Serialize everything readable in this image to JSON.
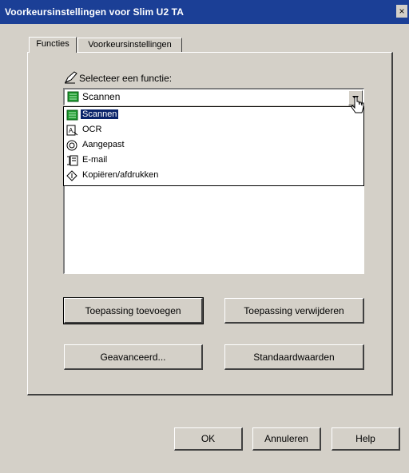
{
  "window": {
    "title": "Voorkeursinstellingen voor Slim U2 TA",
    "close_glyph": "×"
  },
  "tabs": [
    {
      "label": "Functies",
      "active": true
    },
    {
      "label": "Voorkeursinstellingen",
      "active": false
    }
  ],
  "select_function": {
    "label": "Selecteer een functie:",
    "icon": "pen-icon",
    "selected": "Scannen",
    "options": [
      {
        "label": "Scannen",
        "icon": "scan-icon",
        "selected": true
      },
      {
        "label": "OCR",
        "icon": "ocr-icon",
        "selected": false
      },
      {
        "label": "Aangepast",
        "icon": "custom-icon",
        "selected": false
      },
      {
        "label": "E-mail",
        "icon": "email-icon",
        "selected": false
      },
      {
        "label": "Kopiëren/afdrukken",
        "icon": "copy-print-icon",
        "selected": false
      }
    ]
  },
  "buttons": {
    "add_app": "Toepassing toevoegen",
    "remove_app": "Toepassing verwijderen",
    "advanced": "Geavanceerd...",
    "defaults": "Standaardwaarden"
  },
  "footer": {
    "ok": "OK",
    "cancel": "Annuleren",
    "help": "Help"
  },
  "colors": {
    "titlebar": "#1b3f96",
    "selection": "#0a246a",
    "face": "#d4d0c8",
    "scan_icon": "#1e9a2e"
  }
}
